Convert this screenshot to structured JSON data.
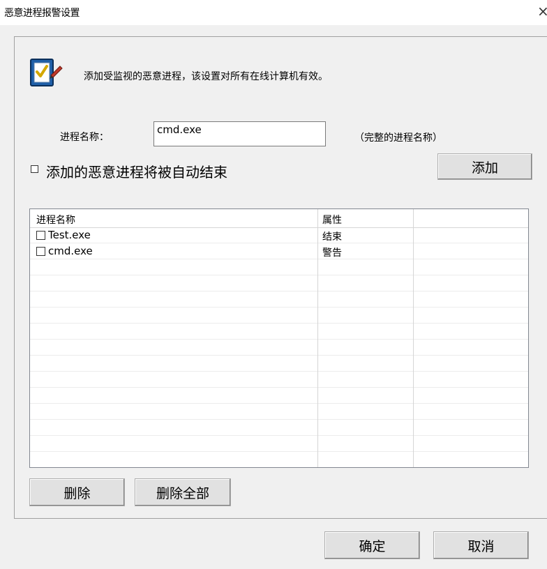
{
  "window": {
    "title": "恶意进程报警设置",
    "close_glyph": "×"
  },
  "header": {
    "icon": "checklist-pen-icon",
    "description": "添加受监视的恶意进程，该设置对所有在线计算机有效。"
  },
  "form": {
    "name_label": "进程名称：",
    "name_value": "cmd.exe",
    "name_hint": "（完整的进程名称）",
    "auto_end_label": "添加的恶意进程将被自动结束",
    "auto_end_checked": false,
    "add_button": "添加"
  },
  "list": {
    "columns": [
      "进程名称",
      "属性",
      ""
    ],
    "rows": [
      {
        "name": "Test.exe",
        "attribute": "结束",
        "checked": false
      },
      {
        "name": "cmd.exe",
        "attribute": "警告",
        "checked": false
      }
    ]
  },
  "actions": {
    "delete_button": "删除",
    "delete_all_button": "删除全部",
    "ok_button": "确定",
    "cancel_button": "取消"
  }
}
